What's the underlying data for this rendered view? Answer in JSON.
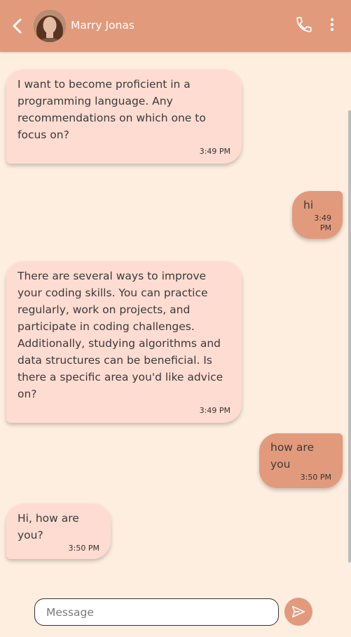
{
  "header": {
    "contact_name": "Marry Jonas",
    "background_color": "#e29a7c",
    "icons": [
      "back-arrow-icon",
      "phone-icon",
      "more-vertical-icon"
    ]
  },
  "messages": [
    {
      "direction": "incoming",
      "text": "I want to become proficient in a programming language. Any recommendations on which one to focus on?",
      "time": "3:49 PM"
    },
    {
      "direction": "outgoing",
      "text": "hi",
      "time": "3:49 PM"
    },
    {
      "direction": "incoming",
      "text": "There are several ways to improve your coding skills. You can practice regularly, work on projects, and participate in coding challenges. Additionally, studying algorithms and data structures can be beneficial. Is there a specific area you'd like advice on?",
      "time": "3:49 PM"
    },
    {
      "direction": "outgoing",
      "text": "how are you",
      "time": "3:50 PM"
    },
    {
      "direction": "incoming",
      "text": "Hi, how are you?",
      "time": "3:50 PM"
    }
  ],
  "composer": {
    "placeholder": "Message",
    "value": ""
  },
  "colors": {
    "page_background": "#fdeee0",
    "incoming_bubble": "#ffdcd2",
    "outgoing_bubble": "#e29a7c",
    "send_button": "#e29a7c"
  }
}
